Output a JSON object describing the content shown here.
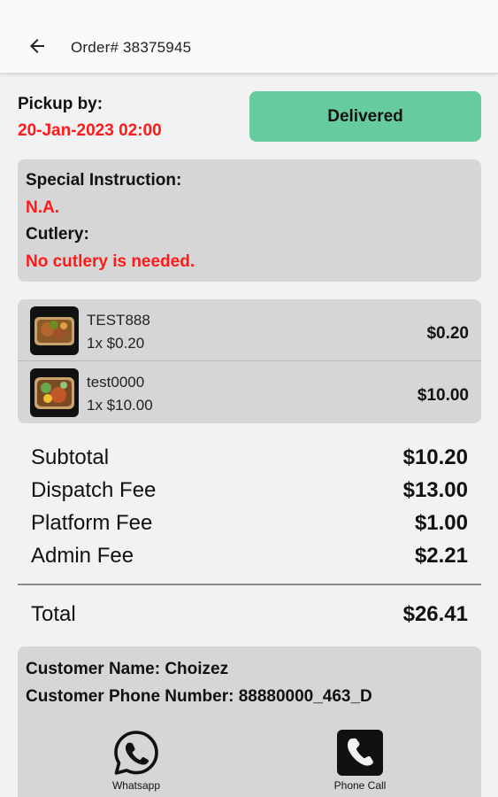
{
  "header": {
    "title": "Order# 38375945",
    "back_icon": "arrow-left-icon"
  },
  "pickup": {
    "label": "Pickup by:",
    "value": "20-Jan-2023 02:00"
  },
  "status": {
    "label": "Delivered",
    "color": "#66cc9f"
  },
  "instructions": {
    "special_label": "Special Instruction:",
    "special_value": "N.A.",
    "cutlery_label": "Cutlery:",
    "cutlery_value": "No cutlery is needed."
  },
  "items": [
    {
      "name": "TEST888",
      "qty": "1x $0.20",
      "price": "$0.20",
      "image": "food-thumbnail"
    },
    {
      "name": "test0000",
      "qty": "1x $10.00",
      "price": "$10.00",
      "image": "food-thumbnail"
    }
  ],
  "summary": {
    "rows": [
      {
        "label": "Subtotal",
        "value": "$10.20"
      },
      {
        "label": "Dispatch Fee",
        "value": "$13.00"
      },
      {
        "label": "Platform Fee",
        "value": "$1.00"
      },
      {
        "label": "Admin Fee",
        "value": "$2.21"
      }
    ],
    "total_label": "Total",
    "total_value": "$26.41"
  },
  "customer": {
    "name_line": "Customer Name: Choizez",
    "phone_line": "Customer Phone Number: 88880000_463_D",
    "whatsapp_label": "Whatsapp",
    "whatsapp_icon": "whatsapp-icon",
    "call_label": "Phone Call",
    "call_icon": "phone-icon"
  },
  "colors": {
    "accent_red": "#ff1a1a",
    "status_green": "#66cc9f",
    "card_gray": "#d6d6d6"
  }
}
